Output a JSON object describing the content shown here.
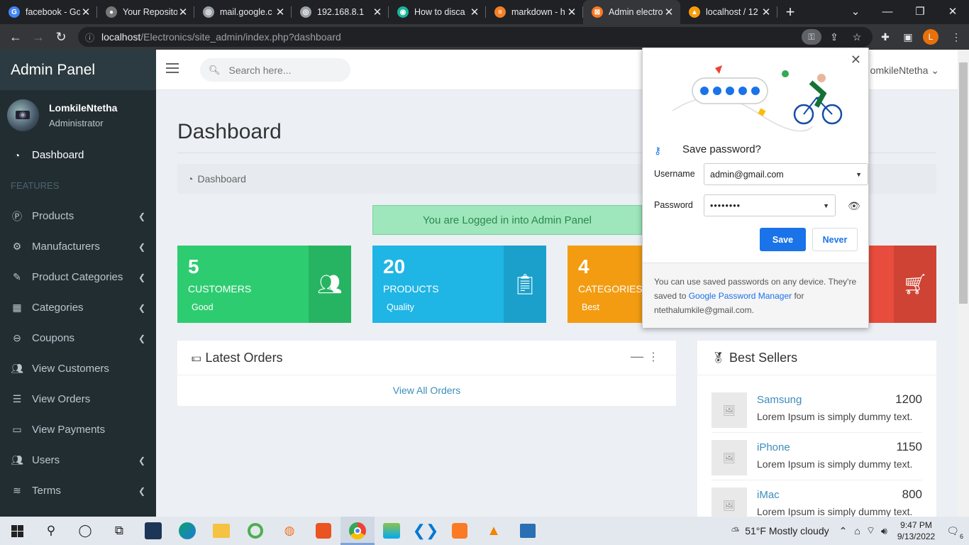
{
  "browser": {
    "tabs": [
      {
        "title": "facebook - Go",
        "icon": "google-icon",
        "color": "#4285f4"
      },
      {
        "title": "Your Reposito",
        "icon": "github-icon",
        "color": "#777777"
      },
      {
        "title": "mail.google.c",
        "icon": "globe-icon",
        "color": "#9aa0a6"
      },
      {
        "title": "192.168.8.1",
        "icon": "globe-icon",
        "color": "#9aa0a6"
      },
      {
        "title": "How to disca",
        "icon": "eye-icon",
        "color": "#18b59b"
      },
      {
        "title": "markdown - h",
        "icon": "stackoverflow-icon",
        "color": "#f48024"
      },
      {
        "title": "Admin electro",
        "icon": "xampp-icon",
        "color": "#fb7a24"
      },
      {
        "title": "localhost / 12",
        "icon": "phpmyadmin-icon",
        "color": "#f89c0e"
      }
    ],
    "url_host": "localhost",
    "url_path": "/Electronics/site_admin/index.php?dashboard",
    "profile_initial": "L"
  },
  "sidebar": {
    "brand": "Admin Panel",
    "user_name": "LomkileNtetha",
    "user_role": "Administrator",
    "dashboard": "Dashboard",
    "section_header": "FEATURES",
    "items": [
      {
        "label": "Products",
        "icon": "product-icon",
        "chevron": true
      },
      {
        "label": "Manufacturers",
        "icon": "gear-icon",
        "chevron": true
      },
      {
        "label": "Product Categories",
        "icon": "edit-icon",
        "chevron": true
      },
      {
        "label": "Categories",
        "icon": "grid-icon",
        "chevron": true
      },
      {
        "label": "Coupons",
        "icon": "minus-circle-icon",
        "chevron": true
      },
      {
        "label": "View Customers",
        "icon": "users-icon",
        "chevron": false
      },
      {
        "label": "View Orders",
        "icon": "list-icon",
        "chevron": false
      },
      {
        "label": "View Payments",
        "icon": "money-icon",
        "chevron": false
      },
      {
        "label": "Users",
        "icon": "users-icon",
        "chevron": true
      },
      {
        "label": "Terms",
        "icon": "stack-icon",
        "chevron": true
      }
    ]
  },
  "topnav": {
    "search_placeholder": "Search here...",
    "user": "omkileNtetha"
  },
  "main": {
    "title": "Dashboard",
    "breadcrumb": "Dashboard",
    "alert": "You are Logged in into Admin Panel",
    "boxes": [
      {
        "number": "5",
        "label": "CUSTOMERS",
        "sub": "Good",
        "icon": "users-icon",
        "color": "#2ecc71",
        "icon_bg": "#27b462"
      },
      {
        "number": "20",
        "label": "PRODUCTS",
        "sub": "Quality",
        "icon": "clipboard-check-icon",
        "color": "#1fb5e5",
        "icon_bg": "#1aa0cb"
      },
      {
        "number": "4",
        "label": "CATEGORIES",
        "sub": "Best",
        "icon": "tag-icon",
        "color": "#f39c12",
        "icon_bg": "#da8c0f"
      },
      {
        "number": "",
        "label": "",
        "sub": "",
        "icon": "cart-plus-icon",
        "color": "#e74c3c",
        "icon_bg": "#cf4334"
      }
    ],
    "latest_orders": {
      "title": "Latest Orders",
      "link": "View All Orders"
    },
    "best_sellers": {
      "title": "Best Sellers",
      "items": [
        {
          "name": "Samsung",
          "price": "1200",
          "desc": "Lorem Ipsum is simply dummy text."
        },
        {
          "name": "iPhone",
          "price": "1150",
          "desc": "Lorem Ipsum is simply dummy text."
        },
        {
          "name": "iMac",
          "price": "800",
          "desc": "Lorem Ipsum is simply dummy text."
        }
      ]
    }
  },
  "password_popup": {
    "title": "Save password?",
    "username_label": "Username",
    "username_value": "admin@gmail.com",
    "password_label": "Password",
    "password_value": "••••••••",
    "save_label": "Save",
    "never_label": "Never",
    "footer_text_1": "You can use saved passwords on any device. They're saved to ",
    "footer_link": "Google Password Manager",
    "footer_text_2": " for ntethalumkile@gmail.com."
  },
  "taskbar": {
    "weather": "51°F  Mostly cloudy",
    "time": "9:47 PM",
    "date": "9/13/2022",
    "notifications": "6"
  }
}
